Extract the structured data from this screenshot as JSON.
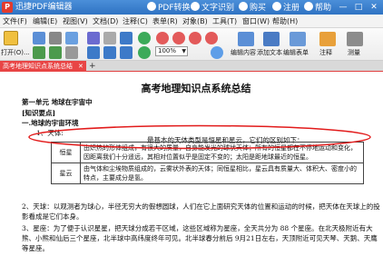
{
  "app": {
    "name": "迅捷PDF编辑器",
    "buttons": {
      "convert": "PDF转换",
      "ocr": "文字识别",
      "buy": "购买",
      "register": "注册",
      "help": "帮助"
    },
    "window_controls": [
      "—",
      "□",
      "✕"
    ]
  },
  "menu": [
    "文件(F)",
    "编辑(E)",
    "视图(V)",
    "文档(D)",
    "注释(C)",
    "表单(R)",
    "对象(B)",
    "工具(T)",
    "窗口(W)",
    "帮助(H)"
  ],
  "toolbar": {
    "open_label": "打开(O)...",
    "zoom_value": "100%",
    "edit_content_label": "编辑内容",
    "add_text_label": "添加文本",
    "edit_form_label": "编辑表单",
    "annotate_label": "注释",
    "measure_label": "测量"
  },
  "tabs": [
    {
      "label": "高考地理知识点系统总结"
    }
  ],
  "document": {
    "title": "高考地理知识点系统总结",
    "unit": "第一单元  地球在宇宙中",
    "section": "[知识要点]",
    "subsection": "一.地球的宇宙环境",
    "item1": "1、天体:",
    "basic_types": "最基本的天体类型是恒星和星云，它们的区别如下：",
    "table": [
      {
        "name": "恒星",
        "desc": "由炽热的形体组成，有很大的质量，自身能发光的球状天体；所有的恒星都在不停地运动和变化，因距离我们十分遥远，其相对位置似乎是固定不变的；太阳是距地球最近的恒星。"
      },
      {
        "name": "星云",
        "desc": "由气体和尘埃物质组成的，云雾状外表的天体；同恒星相比，星云具有质量大、体积大、密度小的特点，主要成分是氢。"
      }
    ],
    "item2": "2、天球：以观测者为球心，半径无穷大的假想圆球，人们在它上面研究天体的位置和运动的时候，把天体在天球上的投影看成是它们本身。",
    "item3": "3、星座：为了便于认识星星，把天球分成若干区域，这些区域称为星座，全天共分为 88 个星座。在北天极附近有大熊、小熊和仙后三个星座，北半球中高纬度终年可见。北半球春分前后 9月21日左右，天顶附近可见天琴、天鹅、天鹰等星座。"
  }
}
